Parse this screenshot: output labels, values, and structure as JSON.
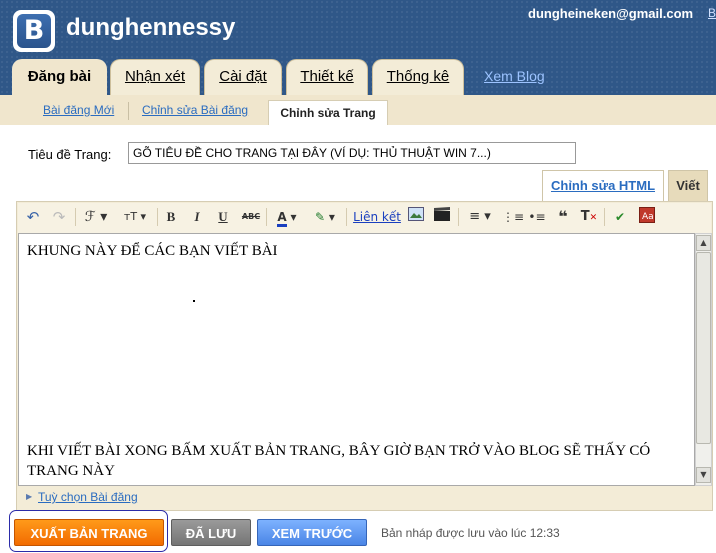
{
  "header": {
    "blog_name": "dunghennessy",
    "user_email": "dungheineken@gmail.com",
    "user_extra_link": "B",
    "logo_letter": "B"
  },
  "main_tabs": [
    {
      "label": "Đăng bài",
      "active": true
    },
    {
      "label": "Nhận xét",
      "active": false
    },
    {
      "label": "Cài đặt",
      "active": false
    },
    {
      "label": "Thiết kế",
      "active": false
    },
    {
      "label": "Thống kê",
      "active": false
    }
  ],
  "view_blog_link": "Xem Blog",
  "sub_tabs": [
    {
      "label": "Bài đăng Mới",
      "active": false
    },
    {
      "label": "Chỉnh sửa Bài đăng",
      "active": false
    },
    {
      "label": "Chỉnh sửa Trang",
      "active": true
    }
  ],
  "title_row": {
    "label": "Tiêu đề Trang:",
    "value": "GÕ TIÊU ĐỀ CHO TRANG TẠI ĐÂY (VÍ DỤ: THỦ THUẬT WIN 7...)"
  },
  "mode_tabs": {
    "html": "Chỉnh sửa HTML",
    "write": "Viết"
  },
  "toolbar": {
    "undo_icon": "↶",
    "redo_icon": "↷",
    "font_icon": "ℱ",
    "font_size_icon": "тT",
    "bold": "B",
    "italic": "I",
    "underline": "U",
    "strike": "ABC",
    "text_color": "A",
    "link_label": "Liên kết"
  },
  "editor": {
    "top_text": "KHUNG NÀY ĐỂ CÁC BẠN VIẾT BÀI",
    "bottom_text": "KHI VIẾT BÀI XONG BẤM XUẤT BẢN TRANG, BÂY GIỜ BẠN TRỞ VÀO BLOG SẼ THẤY CÓ TRANG NÀY"
  },
  "post_options_label": "Tuỳ chọn Bài đăng",
  "buttons": {
    "publish": "XUẤT BẢN TRANG",
    "saved": "ĐÃ LƯU",
    "preview": "XEM TRƯỚC"
  },
  "draft_status": "Bản nháp được lưu vào lúc 12:33",
  "colors": {
    "header_bg": "#2f5788",
    "tab_bg": "#f0e6cd",
    "publish_orange": "#f26b00",
    "preview_blue": "#4a85e6",
    "link_blue": "#2a6cc0"
  }
}
